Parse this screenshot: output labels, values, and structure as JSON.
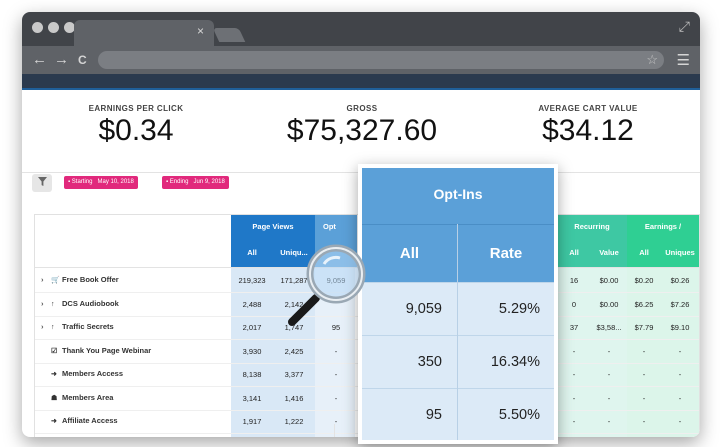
{
  "browser": {
    "tab_close": "×",
    "nav_back": "←",
    "nav_forward": "→",
    "nav_reload": "C",
    "star": "☆",
    "menu": "☰",
    "expand": "⤢"
  },
  "stats": [
    {
      "label": "EARNINGS PER CLICK",
      "value": "$0.34"
    },
    {
      "label": "GROSS",
      "value": "$75,327.60"
    },
    {
      "label": "AVERAGE CART VALUE",
      "value": "$34.12"
    }
  ],
  "filters": {
    "filter_icon": "funnel-icon",
    "starting_label": "Starting",
    "starting_date": "May 10, 2018",
    "ending_label": "Ending",
    "ending_date": "Jun 9, 2018"
  },
  "table": {
    "groups": {
      "page_views": "Page Views",
      "opt_ins_partial": "Opt",
      "recurring_partial": "Recurring",
      "earnings_pageview": "Earnings / Pageview"
    },
    "subheaders": {
      "pv_all": "All",
      "pv_uniques": "Uniqu...",
      "rec_all": "All",
      "rec_value": "Value",
      "epv_all": "All",
      "epv_uniques": "Uniques"
    },
    "rows": [
      {
        "name": "Free Book Offer",
        "icon": "cart-icon",
        "expandable": true,
        "pv_all": "219,323",
        "pv_uniques": "171,287",
        "opt": "9,059",
        "rec_all": "16",
        "rec_value": "$0.00",
        "epv_all": "$0.20",
        "epv_uniques": "$0.26"
      },
      {
        "name": "DCS Audiobook",
        "icon": "arrow-up-icon",
        "expandable": true,
        "pv_all": "2,488",
        "pv_uniques": "2,142",
        "opt": "",
        "rec_all": "0",
        "rec_value": "$0.00",
        "epv_all": "$6.25",
        "epv_uniques": "$7.26"
      },
      {
        "name": "Traffic Secrets",
        "icon": "arrow-up-icon",
        "expandable": true,
        "pv_all": "2,017",
        "pv_uniques": "1,747",
        "opt": "95",
        "rec_all": "37",
        "rec_value": "$3,58...",
        "epv_all": "$7.79",
        "epv_uniques": "$9.10"
      },
      {
        "name": "Thank You Page Webinar",
        "icon": "check-square-icon",
        "expandable": false,
        "pv_all": "3,930",
        "pv_uniques": "2,425",
        "opt": "-",
        "rec_all": "-",
        "rec_value": "-",
        "epv_all": "-",
        "epv_uniques": "-"
      },
      {
        "name": "Members Access",
        "icon": "sign-in-icon",
        "expandable": false,
        "pv_all": "8,138",
        "pv_uniques": "3,377",
        "opt": "-",
        "rec_all": "-",
        "rec_value": "-",
        "epv_all": "-",
        "epv_uniques": "-"
      },
      {
        "name": "Members Area",
        "icon": "users-icon",
        "expandable": false,
        "pv_all": "3,141",
        "pv_uniques": "1,416",
        "opt": "-",
        "rec_all": "-",
        "rec_value": "-",
        "epv_all": "-",
        "epv_uniques": "-"
      },
      {
        "name": "Affiliate Access",
        "icon": "sign-in-icon",
        "expandable": false,
        "pv_all": "1,917",
        "pv_uniques": "1,222",
        "opt": "-",
        "rec_all": "-",
        "rec_value": "-",
        "epv_all": "-",
        "epv_uniques": "-"
      }
    ]
  },
  "overlay": {
    "title": "Opt-Ins",
    "col_all": "All",
    "col_rate": "Rate",
    "rows": [
      {
        "all": "9,059",
        "rate": "5.29%"
      },
      {
        "all": "350",
        "rate": "16.34%"
      },
      {
        "all": "95",
        "rate": "5.50%"
      }
    ]
  },
  "colors": {
    "page_views_header": "#1f78c8",
    "page_views_cell": "#d9e8f6",
    "opt_header": "#5ba0d8",
    "recurring_header": "#3ec8a3",
    "recurring_cell": "#dff5ee",
    "earnings_header": "#2fcf93",
    "earnings_cell": "#dcf5ea",
    "pill": "#e1297c"
  }
}
